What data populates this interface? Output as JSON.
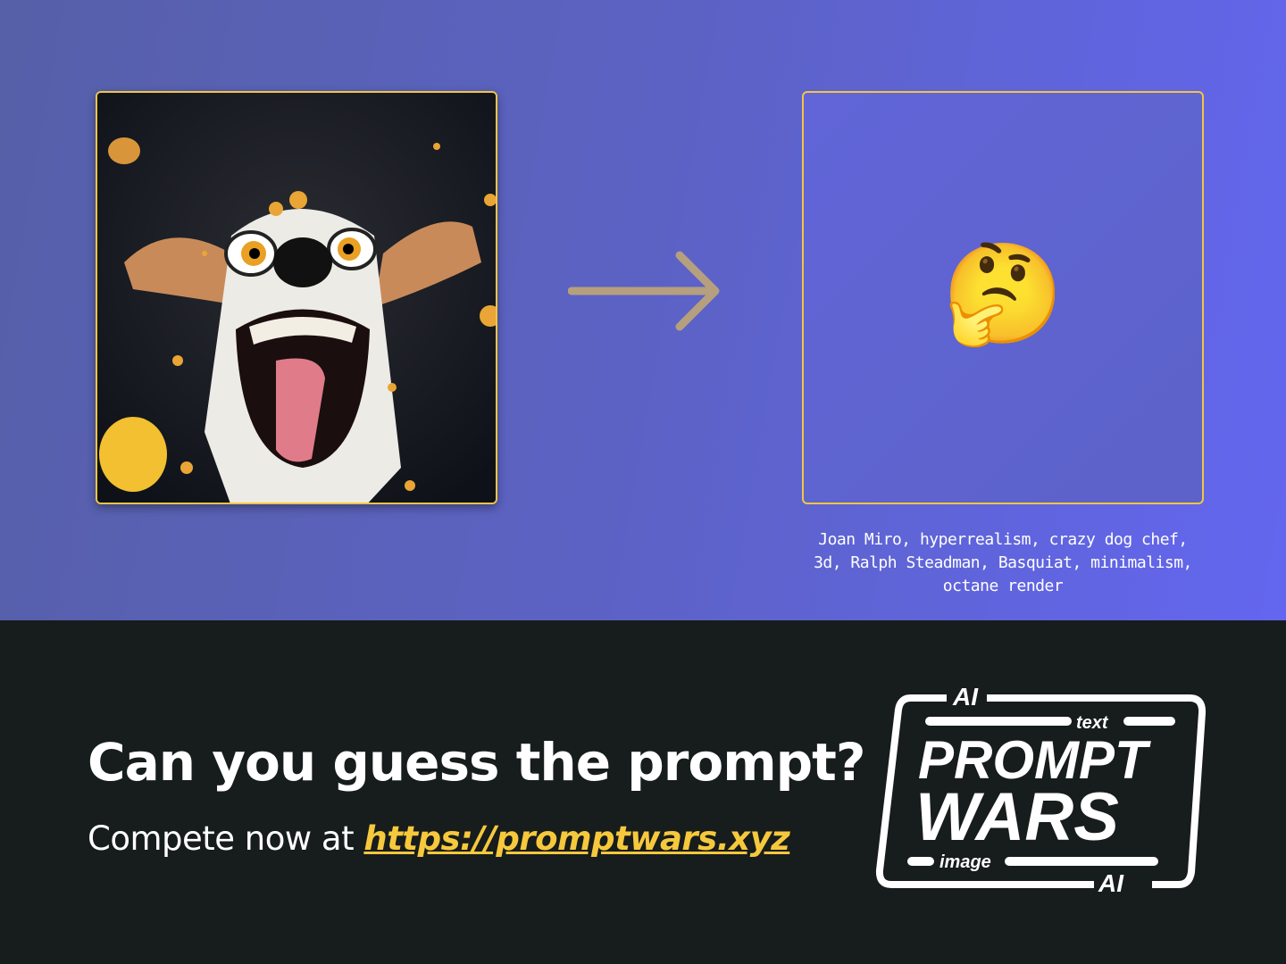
{
  "prompt_text": "Joan Miro, hyperrealism, crazy dog chef, 3d, Ralph Steadman, Basquiat, minimalism, octane render",
  "mystery_emoji": "🤔",
  "headline": "Can you guess the prompt?",
  "cta_prefix": "Compete now at ",
  "cta_link": "https://promptwars.xyz",
  "logo": {
    "top": "AI",
    "line1": "text",
    "word1": "PROMPT",
    "word2": "WARS",
    "line2": "image",
    "bottom": "AI"
  },
  "colors": {
    "accent": "#f6c83c",
    "dark": "#171c1c",
    "arrow": "#b59f7f"
  }
}
